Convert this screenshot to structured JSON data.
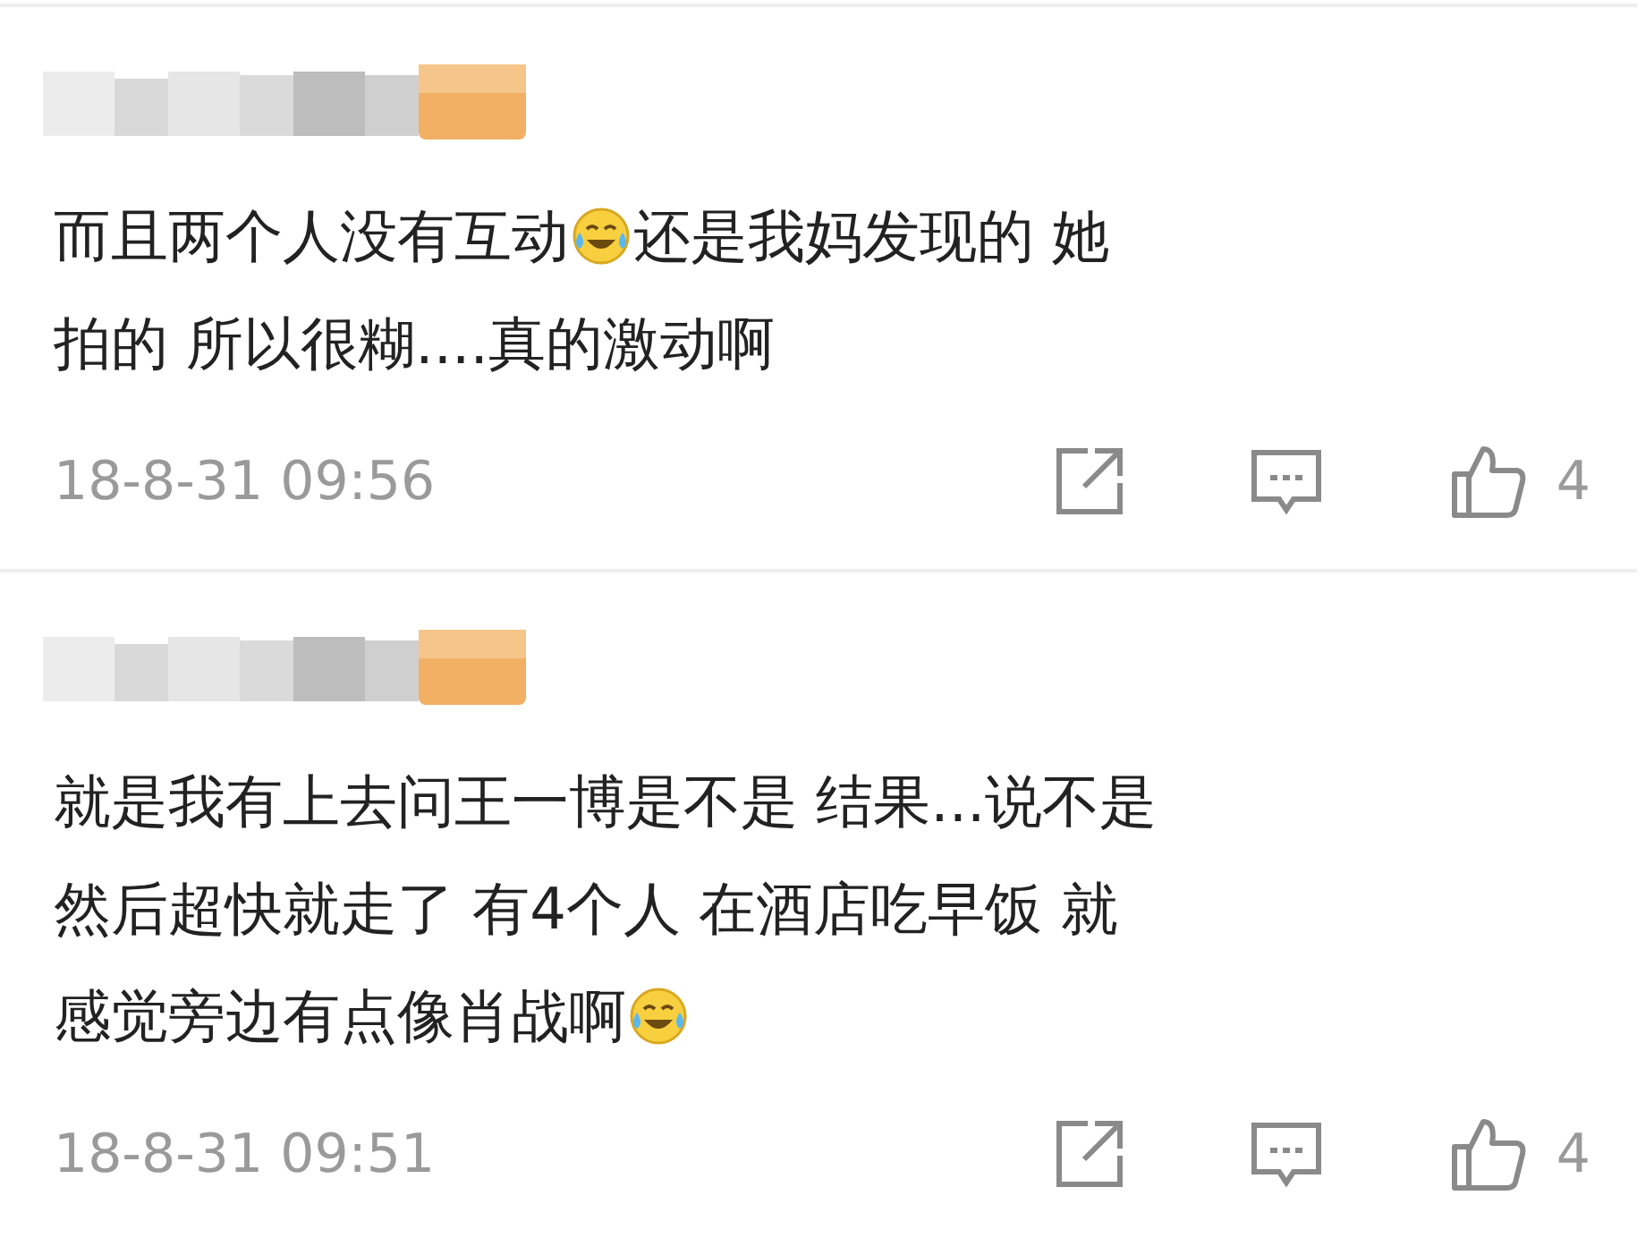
{
  "comments": [
    {
      "lines": [
        [
          {
            "kind": "text",
            "text": "而且两个人没有互动"
          },
          {
            "kind": "emoji"
          },
          {
            "kind": "text",
            "text": "还是我妈发现的 她"
          }
        ],
        [
          {
            "kind": "text",
            "text": "拍的 所以很糊....真的激动啊"
          }
        ]
      ],
      "time": "18-8-31 09:56",
      "likes": "4"
    },
    {
      "lines": [
        [
          {
            "kind": "text",
            "text": "就是我有上去问王一博是不是 结果...说不是"
          }
        ],
        [
          {
            "kind": "text",
            "text": "然后超快就走了 有4个人 在酒店吃早饭 就"
          }
        ],
        [
          {
            "kind": "text",
            "text": "感觉旁边有点像肖战啊"
          },
          {
            "kind": "emoji"
          }
        ]
      ],
      "time": "18-8-31 09:51",
      "likes": "4"
    }
  ]
}
